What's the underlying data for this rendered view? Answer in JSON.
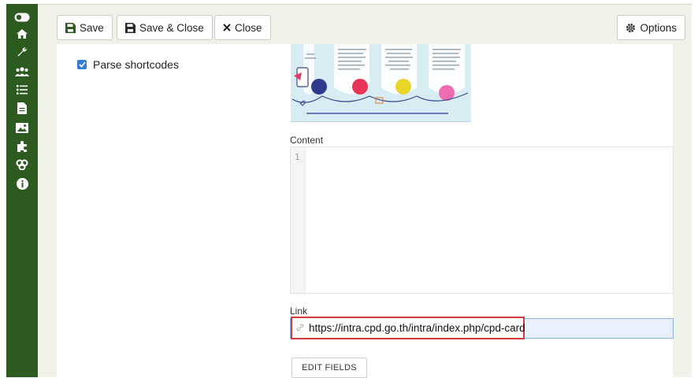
{
  "toolbar": {
    "save_label": "Save",
    "save_close_label": "Save & Close",
    "close_label": "Close",
    "options_label": "Options"
  },
  "options": {
    "parse_shortcodes_label": "Parse shortcodes",
    "parse_shortcodes_checked": true
  },
  "content": {
    "label": "Content",
    "line_number": "1",
    "value": ""
  },
  "link": {
    "label": "Link",
    "value": "https://intra.cpd.go.th/intra/index.php/cpd-card"
  },
  "edit_fields_label": "EDIT FIELDS",
  "sidebar": {
    "icons": [
      "toggle-icon",
      "home-icon",
      "wrench-icon",
      "users-icon",
      "list-icon",
      "file-icon",
      "image-icon",
      "puzzle-icon",
      "groups-icon",
      "info-icon"
    ]
  },
  "colors": {
    "sidebar": "#2d5a1e",
    "background": "#eef2e9",
    "highlight": "#d43c3c",
    "checkbox": "#3a7bd5"
  }
}
